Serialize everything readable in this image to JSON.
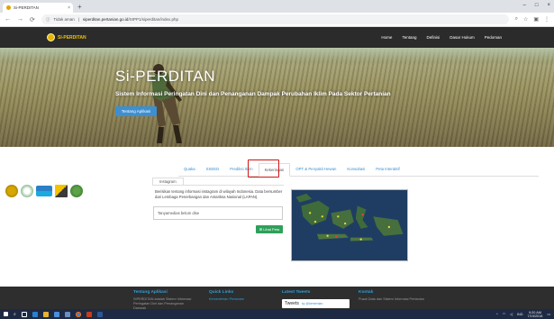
{
  "browser": {
    "tab_title": "Si-PERDITAN",
    "tab_close": "×",
    "new_tab": "+",
    "window_controls": [
      "–",
      "□",
      "×"
    ],
    "nav": {
      "back": "←",
      "forward": "→",
      "reload": "⟳"
    },
    "security_label": "Tidak aman",
    "url_domain": "siperditan.pertanian.go.id",
    "url_path": "/SIPP1/siperditan/index.php",
    "ext_icons": [
      "zoom-icon",
      "star-icon",
      "extension-icon",
      "menu-icon"
    ]
  },
  "site": {
    "brand": "SI-PERDITAN",
    "menu": [
      "Home",
      "Tentang",
      "Definisi",
      "Dasar Hukum",
      "Pedoman"
    ]
  },
  "hero": {
    "title": "Si-PERDITAN",
    "subtitle": "Sistem Informasi Peringatan Dini dan Penanganan Dampak Perubahan Iklim Pada Sektor Pertanian",
    "button": "Tentang Aplikasi"
  },
  "main": {
    "tabs": [
      "Quaka",
      "SSEED",
      "Prediksi Iklim",
      "Kekeringan",
      "OPT & Penyakit Hewan",
      "Konsultasi",
      "Peta Interaktif"
    ],
    "active_tab": "Kekeringan",
    "inner_tab": "Instagram",
    "description": "Berisikan tentang informasi instagram di wilayah Indonesia. Data bersumber dari Lembaga Penerbangan dan Antariksa Nasional (LAPAN).",
    "notice": "Tanyamedias belum dise",
    "map_button": "Lihat Peta",
    "logos": [
      "Kementan",
      "BMKG",
      "LAPAN",
      "PU",
      "BNPB"
    ]
  },
  "footer": {
    "col1": {
      "title": "Tentang Aplikasi",
      "body": "SIPERDITAN adalah Sistem Informasi Peringatan Dini dan Penanganan Dampak"
    },
    "col2": {
      "title": "Quick Links",
      "body": "Kementerian Pertanian"
    },
    "col3": {
      "title": "Latest Tweets",
      "tweets_label": "Tweets",
      "by": "by @kementan"
    },
    "col4": {
      "title": "Kontak",
      "body": "Pusat Data dan Sistem Informasi Pertanian"
    }
  },
  "taskbar": {
    "lang": "IND",
    "time": "9:20 AM",
    "date": "7/19/2018"
  },
  "colors": {
    "nav_bg": "#2b2b2b",
    "brand": "#f2c200",
    "accent_blue": "#3d8fd0",
    "highlight_red": "#d01515",
    "map_button": "#2ea05a",
    "footer_heading": "#2e9fd8"
  }
}
